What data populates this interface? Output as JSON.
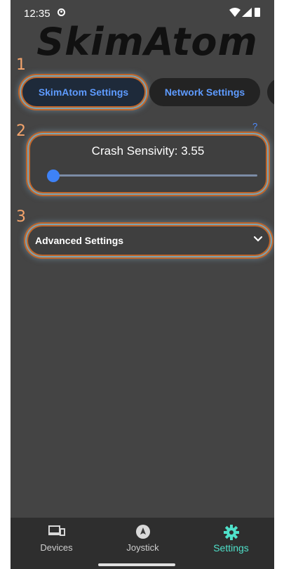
{
  "status_bar": {
    "time": "12:35"
  },
  "app": {
    "title": "SkimAtom"
  },
  "steps": [
    "1",
    "2",
    "3"
  ],
  "tabs": {
    "skimatom_settings": "SkimAtom Settings",
    "network_settings": "Network Settings"
  },
  "help": {
    "mark": "?"
  },
  "sensitivity": {
    "label": "Crash Sensivity: 3.55",
    "value": 3.55,
    "fraction": 0.0
  },
  "advanced": {
    "label": "Advanced Settings"
  },
  "bottom_nav": {
    "devices": "Devices",
    "joystick": "Joystick",
    "settings": "Settings"
  },
  "colors": {
    "accent_blue": "#3e82f7",
    "active_nav": "#4fe0c9",
    "step_number": "#f4a46c",
    "background": "#444444"
  }
}
